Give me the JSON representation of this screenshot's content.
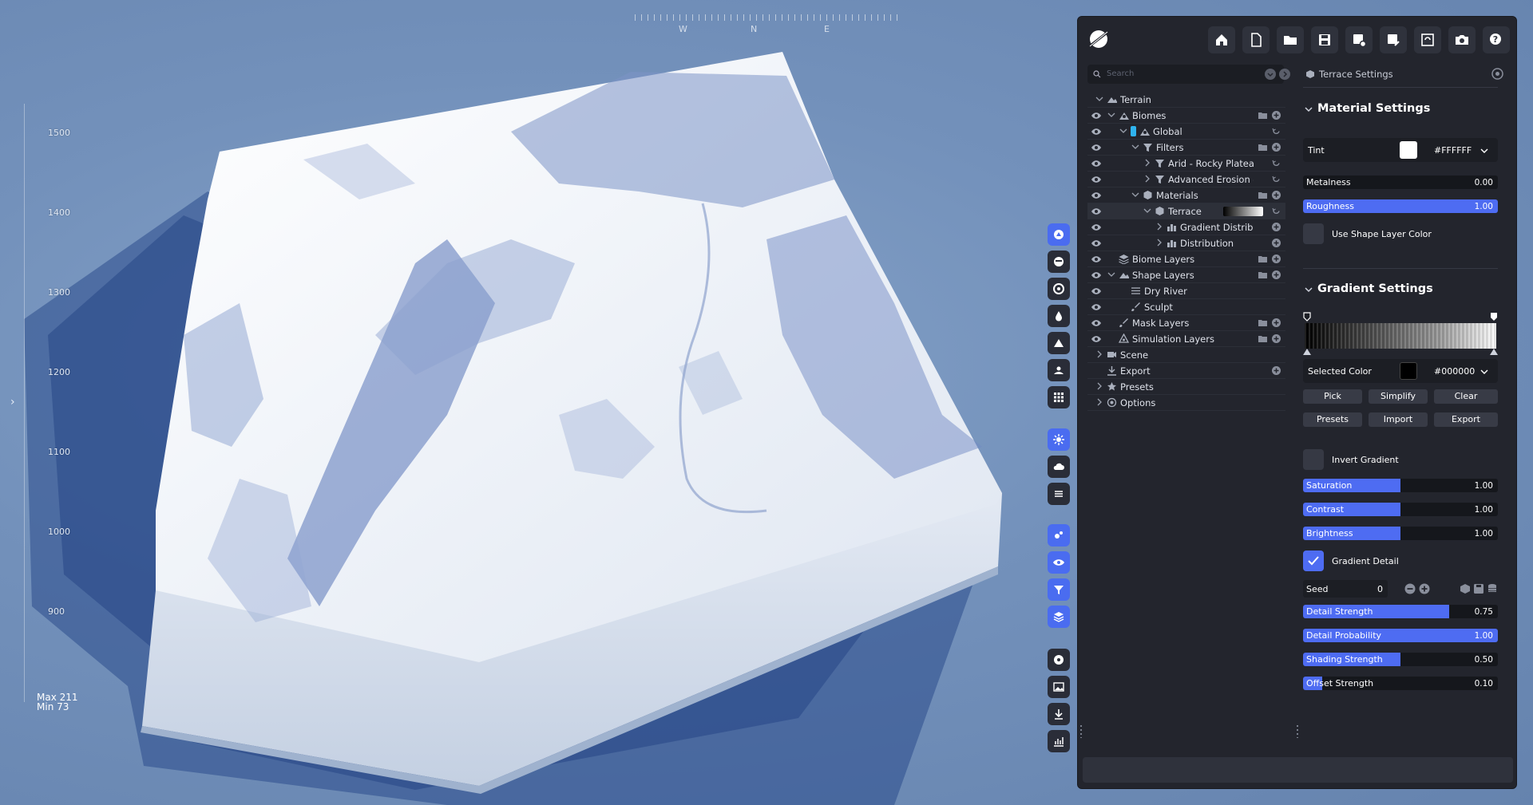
{
  "viewport": {
    "scale_ticks": [
      "1500",
      "1400",
      "1300",
      "1200",
      "1100",
      "1000",
      "900"
    ],
    "max_label": "Max 211",
    "min_label": "Min 73",
    "compass": [
      "W",
      "N",
      "E"
    ]
  },
  "tree": {
    "search_placeholder": "Search",
    "rows": [
      {
        "label": "Terrain"
      },
      {
        "label": "Biomes"
      },
      {
        "label": "Global"
      },
      {
        "label": "Filters"
      },
      {
        "label": "Arid - Rocky Plateaus"
      },
      {
        "label": "Advanced Erosion - Sc"
      },
      {
        "label": "Materials"
      },
      {
        "label": "Terrace"
      },
      {
        "label": "Gradient Distributi"
      },
      {
        "label": "Distribution"
      },
      {
        "label": "Biome Layers"
      },
      {
        "label": "Shape Layers"
      },
      {
        "label": "Dry River"
      },
      {
        "label": "Sculpt"
      },
      {
        "label": "Mask Layers"
      },
      {
        "label": "Simulation Layers"
      },
      {
        "label": "Scene"
      },
      {
        "label": "Export"
      },
      {
        "label": "Presets"
      },
      {
        "label": "Options"
      }
    ]
  },
  "settings": {
    "header": "Terrace Settings",
    "material": {
      "title": "Material Settings",
      "tint_label": "Tint",
      "tint_hex": "#FFFFFF",
      "metalness_label": "Metalness",
      "metalness_value": "0.00",
      "metalness_level": 0.0,
      "roughness_label": "Roughness",
      "roughness_value": "1.00",
      "roughness_level": 1.0,
      "use_shape_color": "Use Shape Layer Color"
    },
    "gradient": {
      "title": "Gradient Settings",
      "selected_color_label": "Selected Color",
      "selected_hex": "#000000",
      "buttons_row1": [
        "Pick",
        "Simplify",
        "Clear"
      ],
      "buttons_row2": [
        "Presets",
        "Import",
        "Export"
      ],
      "invert_label": "Invert Gradient",
      "saturation_label": "Saturation",
      "saturation_value": "1.00",
      "saturation_level": 0.5,
      "contrast_label": "Contrast",
      "contrast_value": "1.00",
      "contrast_level": 0.5,
      "brightness_label": "Brightness",
      "brightness_value": "1.00",
      "brightness_level": 0.5,
      "detail_label": "Gradient Detail",
      "seed_label": "Seed",
      "seed_value": "0",
      "detail_strength_label": "Detail Strength",
      "detail_strength_value": "0.75",
      "detail_strength_level": 0.75,
      "detail_prob_label": "Detail Probability",
      "detail_prob_value": "1.00",
      "detail_prob_level": 1.0,
      "shading_label": "Shading Strength",
      "shading_value": "0.50",
      "shading_level": 0.5,
      "offset_label": "Offset Strength",
      "offset_value": "0.10",
      "offset_level": 0.1
    }
  },
  "colors": {
    "accent": "#4e6cf2",
    "panel": "#23252d",
    "sky": "#7391bb"
  }
}
